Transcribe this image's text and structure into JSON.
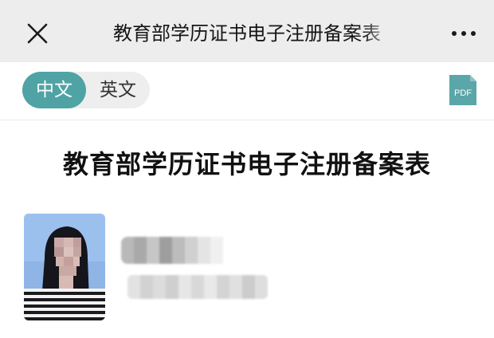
{
  "nav": {
    "title": "教育部学历证书电子注册备案表",
    "close_icon": "close-icon",
    "more_icon": "more-dots-icon"
  },
  "toolbar": {
    "lang_zh": "中文",
    "lang_en": "英文",
    "selected_lang": "中文",
    "pdf_label": "PDF",
    "accent_color": "#4fa3a5"
  },
  "document": {
    "title": "教育部学历证书电子注册备案表"
  }
}
